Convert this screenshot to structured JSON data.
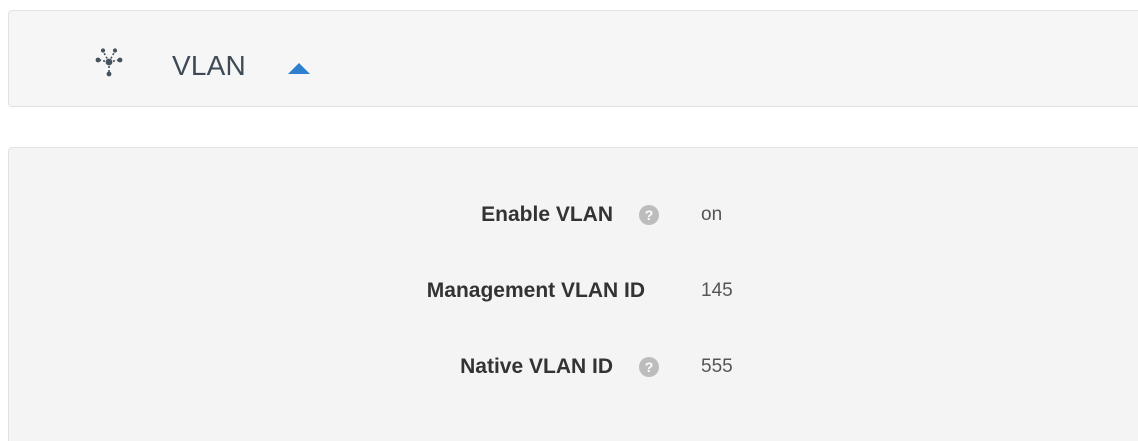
{
  "header": {
    "icon": "network-nodes-icon",
    "title": "VLAN",
    "toggle_icon": "caret-up-icon",
    "accent_color": "#2f7fcf"
  },
  "settings": {
    "rows": [
      {
        "label": "Enable VLAN",
        "has_help": true,
        "help_glyph": "?",
        "value": "on"
      },
      {
        "label": "Management VLAN ID",
        "has_help": false,
        "value": "145"
      },
      {
        "label": "Native VLAN ID",
        "has_help": true,
        "help_glyph": "?",
        "value": "555"
      }
    ]
  }
}
